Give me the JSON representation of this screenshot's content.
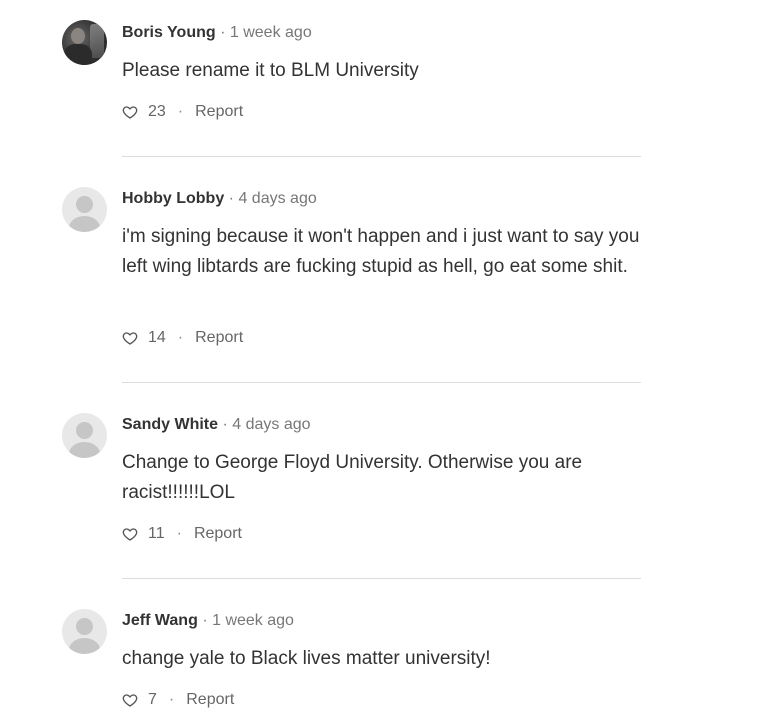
{
  "comments": [
    {
      "author": "Boris Young",
      "separator": "·",
      "time": "1 week ago",
      "text": "Please rename it to BLM University",
      "likes": "23",
      "dot": "·",
      "report_label": "Report",
      "avatar": "photo-avatar"
    },
    {
      "author": "Hobby Lobby",
      "separator": "·",
      "time": "4 days ago",
      "text": "i'm signing because it won't happen and i just want to say you left wing libtards are fucking stupid as hell, go eat some shit.",
      "likes": "14",
      "dot": "·",
      "report_label": "Report",
      "avatar": "default-user-avatar"
    },
    {
      "author": "Sandy White",
      "separator": "·",
      "time": "4 days ago",
      "text": "Change to George Floyd University. Otherwise you are racist!!!!!!LOL",
      "likes": "11",
      "dot": "·",
      "report_label": "Report",
      "avatar": "default-user-avatar"
    },
    {
      "author": "Jeff Wang",
      "separator": "·",
      "time": "1 week ago",
      "text": "change yale to Black lives matter university!",
      "likes": "7",
      "dot": "·",
      "report_label": "Report",
      "avatar": "default-user-avatar"
    }
  ],
  "icons": {
    "like": "heart-icon"
  },
  "colors": {
    "text": "#333333",
    "muted": "#777777",
    "divider": "#dcdcdc",
    "avatar_placeholder": "#c6c6c6"
  }
}
